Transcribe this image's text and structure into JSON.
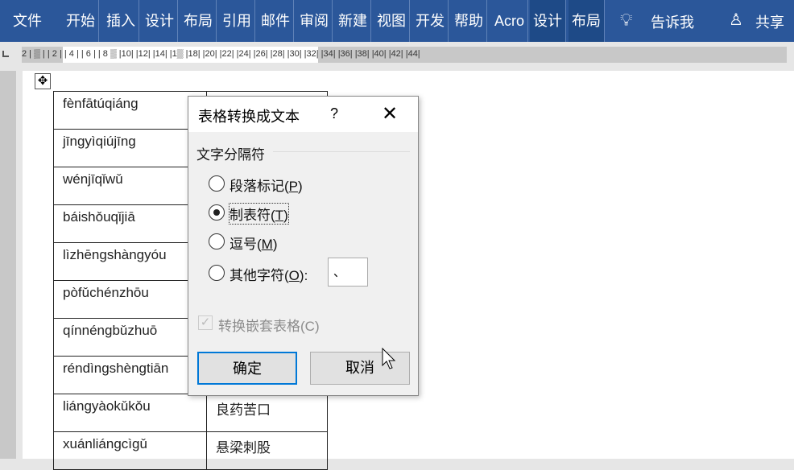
{
  "ribbon": {
    "tabs": [
      "文件",
      "开始",
      "插入",
      "设计",
      "布局",
      "引用",
      "邮件",
      "审阅",
      "新建",
      "视图",
      "开发",
      "帮助",
      "Acro",
      "设计",
      "布局"
    ],
    "tell_me": "告诉我",
    "share": "共享"
  },
  "ruler": {
    "labels": "2 | ▒ |  | 2 |  | 4 |  | 6 |  | 8 ▒ |10|  |12|  |14|  |1▒  |18|  |20|  |22|  |24|  |26|  |28|  |30|  |32|  |34|  |36|  |38|  |40|  |42|  |44|"
  },
  "table": {
    "rows": [
      [
        "fènfātúqiáng",
        ""
      ],
      [
        "jīngyìqiújīng",
        ""
      ],
      [
        "wénjīqǐwǔ",
        ""
      ],
      [
        "báishǒuqǐjiā",
        ""
      ],
      [
        "lìzhēngshàngyóu",
        ""
      ],
      [
        "pòfǔchénzhōu",
        ""
      ],
      [
        "qínnéngbǔzhuō",
        ""
      ],
      [
        "réndìngshèngtiān",
        ""
      ],
      [
        "liángyàokǔkǒu",
        "良药苦口"
      ],
      [
        "xuánliángcìgǔ",
        "悬梁刺股"
      ]
    ]
  },
  "dialog": {
    "title": "表格转换成文本",
    "help": "?",
    "group": "文字分隔符",
    "options": [
      {
        "label": "段落标记(",
        "key": "P",
        "end": ")",
        "checked": false
      },
      {
        "label": "制表符(",
        "key": "T",
        "end": ")",
        "checked": true
      },
      {
        "label": "逗号(",
        "key": "M",
        "end": ")",
        "checked": false
      },
      {
        "label": "其他字符(",
        "key": "O",
        "end": "):",
        "checked": false
      }
    ],
    "other_value": "、",
    "nested": "转换嵌套表格(C)",
    "ok": "确定",
    "cancel": "取消"
  }
}
